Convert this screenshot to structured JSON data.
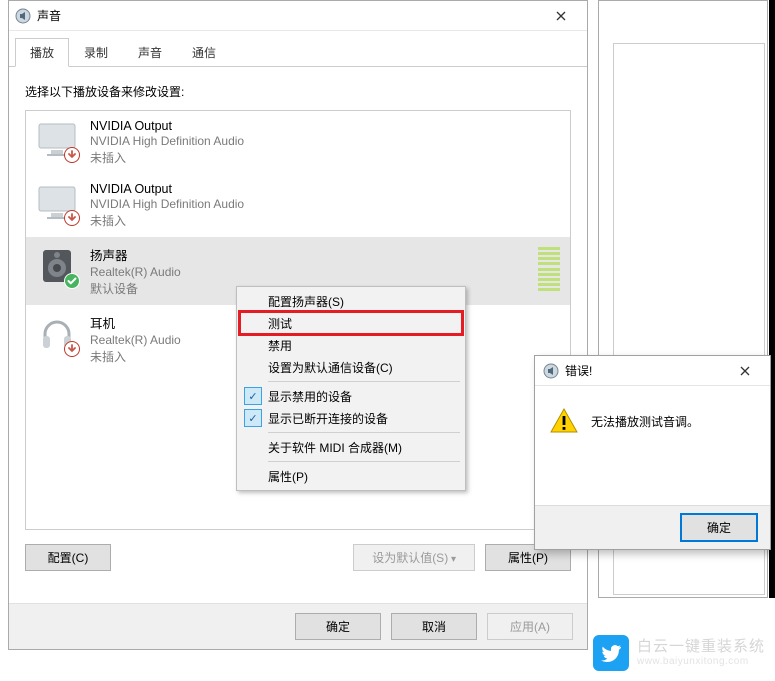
{
  "sound_dialog": {
    "title": "声音",
    "tabs": {
      "playback": "播放",
      "recording": "录制",
      "sounds": "声音",
      "communications": "通信"
    },
    "instruction": "选择以下播放设备来修改设置:",
    "devices": [
      {
        "name": "NVIDIA Output",
        "driver": "NVIDIA High Definition Audio",
        "status": "未插入"
      },
      {
        "name": "NVIDIA Output",
        "driver": "NVIDIA High Definition Audio",
        "status": "未插入"
      },
      {
        "name": "扬声器",
        "driver": "Realtek(R) Audio",
        "status": "默认设备"
      },
      {
        "name": "耳机",
        "driver": "Realtek(R) Audio",
        "status": "未插入"
      }
    ],
    "buttons": {
      "configure": "配置(C)",
      "set_default": "设为默认值(S)",
      "properties": "属性(P)"
    },
    "footer": {
      "ok": "确定",
      "cancel": "取消",
      "apply": "应用(A)"
    }
  },
  "context_menu": {
    "configure_speakers": "配置扬声器(S)",
    "test": "测试",
    "disable": "禁用",
    "set_default_comm": "设置为默认通信设备(C)",
    "show_disabled": "显示禁用的设备",
    "show_disconnected": "显示已断开连接的设备",
    "about_midi": "关于软件 MIDI 合成器(M)",
    "properties": "属性(P)"
  },
  "error_dialog": {
    "title": "错误!",
    "message": "无法播放测试音调。",
    "ok": "确定"
  },
  "watermark": {
    "line1": "白云一键重装系统",
    "line2": "www.baiyunxitong.com"
  }
}
